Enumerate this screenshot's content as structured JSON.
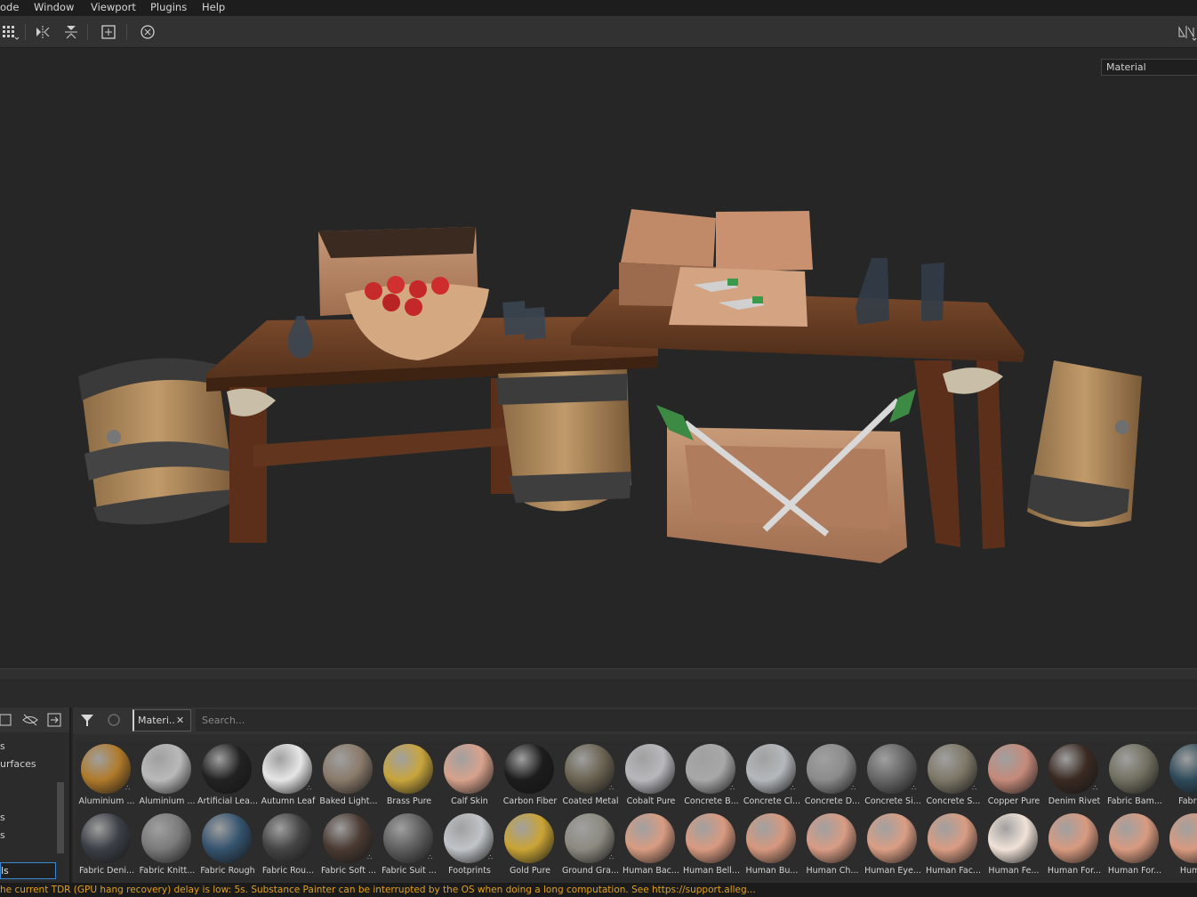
{
  "menu": [
    "ode",
    "Window",
    "Viewport",
    "Plugins",
    "Help"
  ],
  "viewport": {
    "mode_label": "Material"
  },
  "left_panel": {
    "items": [
      "s",
      "urfaces",
      "",
      "",
      "s",
      "s"
    ],
    "selected": "ls"
  },
  "shelf": {
    "filter_chip": "Materi..",
    "search_placeholder": "Search...",
    "row1": [
      {
        "label": "Aluminium ...",
        "color": "#b07a2a",
        "dots": true
      },
      {
        "label": "Aluminium ...",
        "color": "#b9b9b9",
        "dots": false
      },
      {
        "label": "Artificial Lea...",
        "color": "#222222",
        "dots": false
      },
      {
        "label": "Autumn Leaf",
        "color": "#e6e6e6",
        "dots": true
      },
      {
        "label": "Baked Light...",
        "color": "#8a7a6a",
        "dots": false
      },
      {
        "label": "Brass Pure",
        "color": "#c8a53c",
        "dots": false
      },
      {
        "label": "Calf Skin",
        "color": "#d8a28c",
        "dots": false
      },
      {
        "label": "Carbon Fiber",
        "color": "#1c1c1c",
        "dots": false
      },
      {
        "label": "Coated Metal",
        "color": "#6b6352",
        "dots": true
      },
      {
        "label": "Cobalt Pure",
        "color": "#b8b8bc",
        "dots": false
      },
      {
        "label": "Concrete B...",
        "color": "#a8a8a8",
        "dots": true
      },
      {
        "label": "Concrete Cl...",
        "color": "#b4b8bc",
        "dots": true
      },
      {
        "label": "Concrete D...",
        "color": "#8c8c8c",
        "dots": true
      },
      {
        "label": "Concrete Si...",
        "color": "#666666",
        "dots": true
      },
      {
        "label": "Concrete S...",
        "color": "#7e7868",
        "dots": true
      },
      {
        "label": "Copper Pure",
        "color": "#c58a7a",
        "dots": false
      },
      {
        "label": "Denim Rivet",
        "color": "#3a2a22",
        "dots": true
      },
      {
        "label": "Fabric Bam...",
        "color": "#727060",
        "dots": false
      },
      {
        "label": "Fabric B",
        "color": "#2e4a5a",
        "dots": false
      }
    ],
    "row2": [
      {
        "label": "Fabric Deni...",
        "color": "#3b3f46",
        "dots": false
      },
      {
        "label": "Fabric Knitt...",
        "color": "#7a7a7a",
        "dots": false
      },
      {
        "label": "Fabric Rough",
        "color": "#34536e",
        "dots": false
      },
      {
        "label": "Fabric Rou...",
        "color": "#444444",
        "dots": false
      },
      {
        "label": "Fabric Soft ...",
        "color": "#4a3a32",
        "dots": true
      },
      {
        "label": "Fabric Suit ...",
        "color": "#5e5e5e",
        "dots": true
      },
      {
        "label": "Footprints",
        "color": "#c0c4c8",
        "dots": true
      },
      {
        "label": "Gold Pure",
        "color": "#caa434",
        "dots": false
      },
      {
        "label": "Ground Gra...",
        "color": "#8c8a80",
        "dots": true
      },
      {
        "label": "Human Bac...",
        "color": "#d89c82",
        "dots": false
      },
      {
        "label": "Human Bell...",
        "color": "#d99a80",
        "dots": false
      },
      {
        "label": "Human Bu...",
        "color": "#d6987e",
        "dots": false
      },
      {
        "label": "Human Ch...",
        "color": "#d89c84",
        "dots": false
      },
      {
        "label": "Human Eye...",
        "color": "#da9e84",
        "dots": false
      },
      {
        "label": "Human Fac...",
        "color": "#d99c82",
        "dots": false
      },
      {
        "label": "Human Fe...",
        "color": "#f0e2d8",
        "dots": false
      },
      {
        "label": "Human For...",
        "color": "#d89a80",
        "dots": false
      },
      {
        "label": "Human For...",
        "color": "#d89a80",
        "dots": false
      },
      {
        "label": "Human",
        "color": "#d89a80",
        "dots": false
      }
    ]
  },
  "status": "he current TDR (GPU hang recovery) delay is low: 5s. Substance Painter can be interrupted by the OS when doing a long computation. See https://support.alleg..."
}
